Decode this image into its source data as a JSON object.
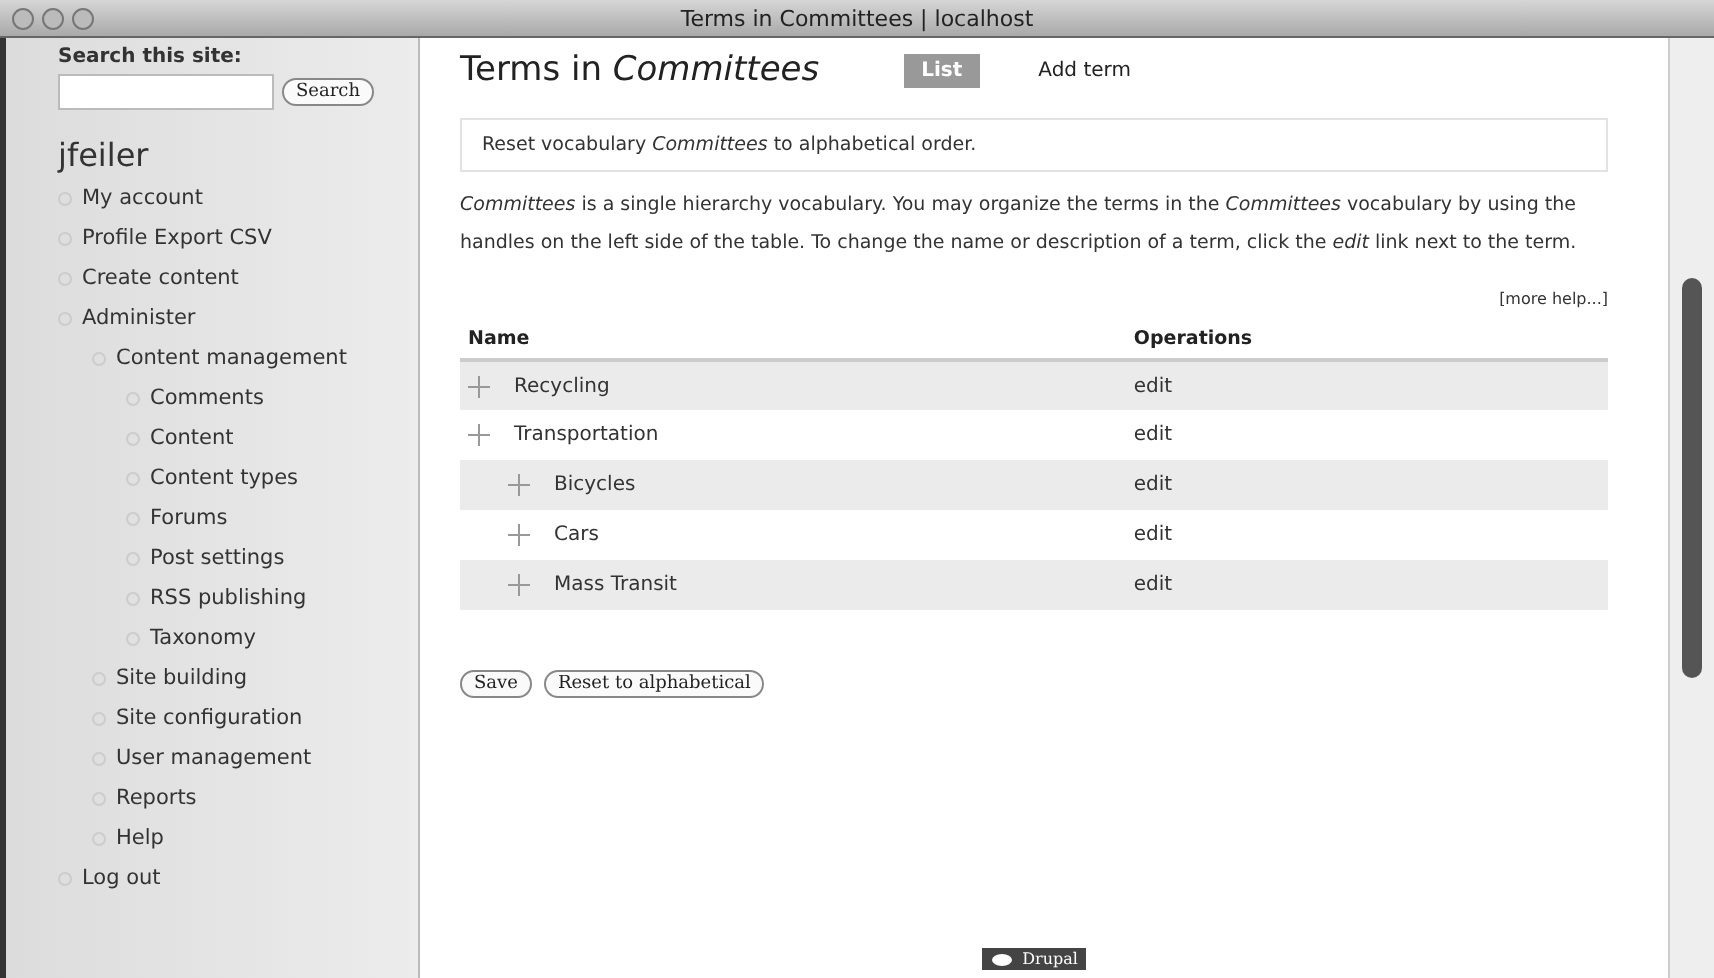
{
  "window": {
    "title": "Terms in Committees | localhost"
  },
  "sidebar": {
    "search_label": "Search this site:",
    "search_button": "Search",
    "user": "jfeiler",
    "menu": [
      {
        "label": "My account"
      },
      {
        "label": "Profile Export CSV"
      },
      {
        "label": "Create content"
      },
      {
        "label": "Administer",
        "children": [
          {
            "label": "Content management",
            "children": [
              {
                "label": "Comments"
              },
              {
                "label": "Content"
              },
              {
                "label": "Content types"
              },
              {
                "label": "Forums"
              },
              {
                "label": "Post settings"
              },
              {
                "label": "RSS publishing"
              },
              {
                "label": "Taxonomy"
              }
            ]
          },
          {
            "label": "Site building"
          },
          {
            "label": "Site configuration"
          },
          {
            "label": "User management"
          },
          {
            "label": "Reports"
          },
          {
            "label": "Help"
          }
        ]
      },
      {
        "label": "Log out"
      }
    ]
  },
  "page": {
    "title": "Terms in *Committees*",
    "tabs": [
      {
        "label": "List",
        "selected": true
      },
      {
        "label": "Add term",
        "selected": false
      }
    ],
    "notice": "Reset vocabulary *Committees* to alphabetical order.",
    "help": "*Committees* is a single hierarchy vocabulary. You may organize the terms in the *Committees* vocabulary by using the handles on the left side of the table. To change the name or description of a term, click the *edit* link next to the term.",
    "more_help": "[more help...]",
    "table": {
      "columns": [
        "Name",
        "Operations"
      ],
      "rows": [
        {
          "name": "Recycling",
          "operation": "edit"
        },
        {
          "name": "Transportation",
          "operation": "edit",
          "children": [
            {
              "name": "Bicycles",
              "operation": "edit"
            },
            {
              "name": "Cars",
              "operation": "edit"
            },
            {
              "name": "Mass Transit",
              "operation": "edit"
            }
          ]
        }
      ]
    },
    "buttons": [
      "Save",
      "Reset to alphabetical"
    ],
    "footer_badge": "Drupal"
  }
}
